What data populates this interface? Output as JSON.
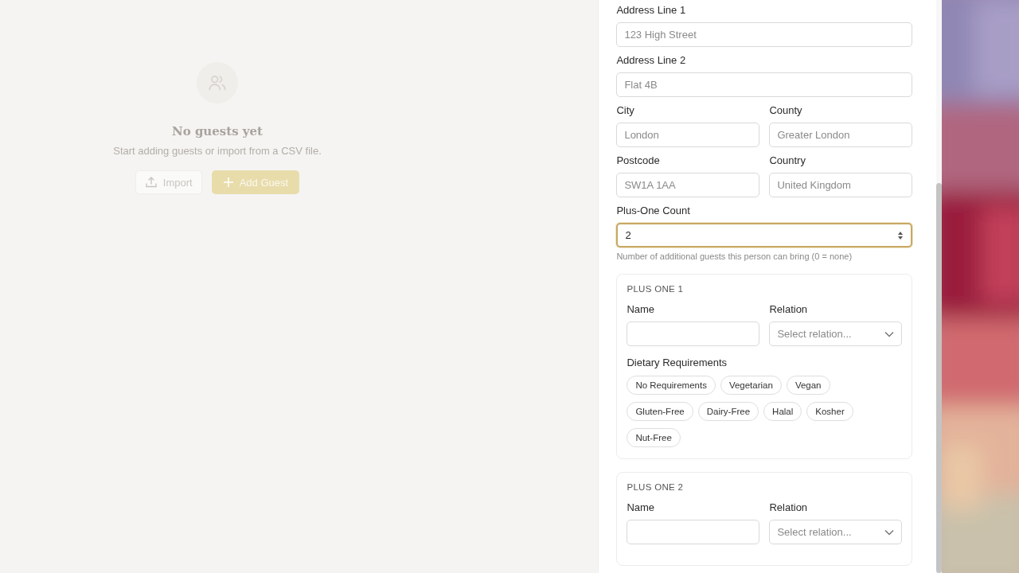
{
  "empty_state": {
    "title": "No guests yet",
    "subtitle": "Start adding guests or import from a CSV file.",
    "buttons": [
      {
        "kind": "secondary",
        "label": "Import"
      },
      {
        "kind": "primary",
        "label": "Add Guest"
      }
    ]
  },
  "form": {
    "rows": [
      {
        "fields": [
          {
            "label": "Address Line 1",
            "placeholder": "123 High Street"
          }
        ]
      },
      {
        "fields": [
          {
            "label": "Address Line 2",
            "placeholder": "Flat 4B"
          }
        ]
      },
      {
        "fields": [
          {
            "label": "City",
            "placeholder": "London"
          },
          {
            "label": "County",
            "placeholder": "Greater London"
          }
        ]
      },
      {
        "fields": [
          {
            "label": "Postcode",
            "placeholder": "SW1A 1AA"
          },
          {
            "label": "Country",
            "placeholder": "United Kingdom"
          }
        ]
      }
    ],
    "plus_one_count": {
      "label": "Plus-One Count",
      "value": "2",
      "focused": true,
      "hint": "Number of additional guests this person can bring (0 = none)"
    },
    "plus_ones": [
      {
        "title": "PLUS ONE 1",
        "name_label": "Name",
        "relation_label": "Relation",
        "relation_placeholder": "Select relation...",
        "dietary_label": "Dietary Requirements",
        "dietary_options": [
          {
            "label": "No Requirements",
            "selected": false
          },
          {
            "label": "Vegetarian",
            "selected": false
          },
          {
            "label": "Vegan",
            "selected": false
          },
          {
            "label": "Gluten-Free",
            "selected": false
          },
          {
            "label": "Dairy-Free",
            "selected": false
          },
          {
            "label": "Halal",
            "selected": false
          },
          {
            "label": "Kosher",
            "selected": false
          },
          {
            "label": "Nut-Free",
            "selected": false
          }
        ]
      },
      {
        "title": "PLUS ONE 2",
        "name_label": "Name",
        "relation_label": "Relation",
        "relation_placeholder": "Select relation..."
      }
    ]
  }
}
